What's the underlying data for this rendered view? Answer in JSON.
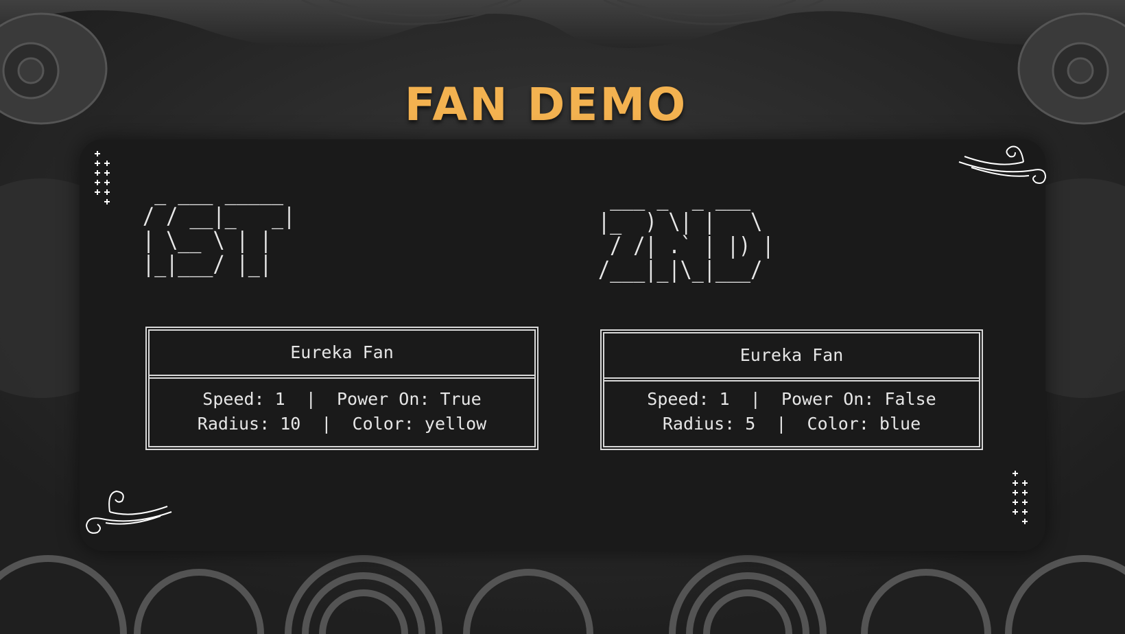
{
  "title": "FAN DEMO",
  "fans": [
    {
      "ascii": " _ ___ _____\n/ / __|_   _|\n| \\__ \\ | |\n|_|___/ |_|",
      "name": "Eureka Fan",
      "line1": "Speed: 1  |  Power On: True",
      "line2": "Radius: 10  |  Color: yellow"
    },
    {
      "ascii": " ___ _  _ ___\n|_  ) \\| |   \\\n / /| .` | |) |\n/___|_|\\_|___/",
      "name": "Eureka Fan",
      "line1": "Speed: 1  |  Power On: False",
      "line2": "Radius: 5  |  Color: blue"
    }
  ],
  "colors": {
    "title": "#f3b250",
    "panel": "#1a1a1a",
    "background": "#2a2a2a"
  },
  "icons": [
    "lantern-icon",
    "wind-swirl-icon",
    "sparkle-plus-icon"
  ]
}
